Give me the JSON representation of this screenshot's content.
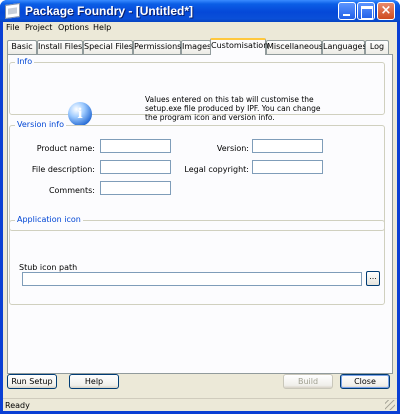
{
  "window": {
    "title": "Package Foundry - [Untitled*]"
  },
  "menu": [
    "File",
    "Project",
    "Options",
    "Help"
  ],
  "tabs": [
    {
      "label": "Basic",
      "active": false
    },
    {
      "label": "Install Files",
      "active": false
    },
    {
      "label": "Special Files",
      "active": false
    },
    {
      "label": "Permissions",
      "active": false
    },
    {
      "label": "Images",
      "active": false
    },
    {
      "label": "Customisation",
      "active": true
    },
    {
      "label": "Miscellaneous",
      "active": false
    },
    {
      "label": "Languages",
      "active": false
    },
    {
      "label": "Log",
      "active": false
    }
  ],
  "info": {
    "group_title": "Info",
    "icon": "info-icon",
    "text": "Values entered on this tab will customise the setup.exe file produced by IPF. You can change the program icon and version info."
  },
  "version_info": {
    "group_title": "Version info",
    "product_name_label": "Product name:",
    "product_name_value": "",
    "version_label": "Version:",
    "version_value": "",
    "file_description_label": "File description:",
    "file_description_value": "",
    "legal_copyright_label": "Legal copyright:",
    "legal_copyright_value": "",
    "comments_label": "Comments:",
    "comments_value": ""
  },
  "application_icon": {
    "group_title": "Application icon",
    "stub_icon_path_label": "Stub icon path",
    "stub_icon_path_value": "",
    "browse_label": "..."
  },
  "buttons": {
    "run_setup": "Run Setup",
    "help": "Help",
    "build": "Build",
    "close": "Close"
  },
  "status": "Ready",
  "colors": {
    "titlebar": "#0548d8",
    "group_title": "#0046d5",
    "active_tab_accent": "#ffc83c",
    "dialog_bg": "#ece9d8"
  }
}
